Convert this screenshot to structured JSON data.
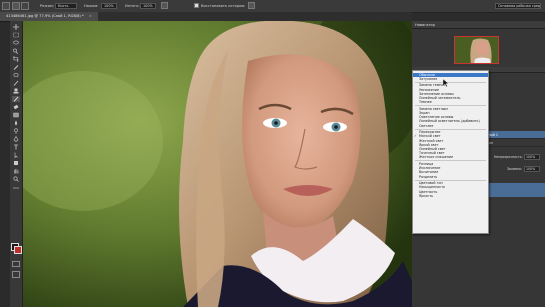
{
  "options_bar": {
    "mode_label": "Режим:",
    "mode_value": "Кисть",
    "pressure_label": "Нажим:",
    "pressure_value": "100%",
    "flow_label": "Интенс.:",
    "flow_value": "100%",
    "restore_history": "Восстановить историю",
    "workspace_value": "Основная рабочая среда"
  },
  "document": {
    "tab_title": "413486461.jpg @ 77,9% (Слой 1, RGB/8) *"
  },
  "panels": {
    "navigator_title": "Навигатор",
    "layers_mode_value": "Обычные",
    "opacity_label": "Непрозрачность:",
    "opacity_value": "100%",
    "fill_label": "Заливка:",
    "fill_value": "100%",
    "layer_items": [
      "Слой 1",
      "Фон"
    ]
  },
  "blend_modes": {
    "groups": [
      [
        "Обычные",
        "Затухание"
      ],
      [
        "Замена темным",
        "Умножение",
        "Затемнение основы",
        "Линейный затемнитель",
        "Темнее"
      ],
      [
        "Замена светлым",
        "Экран",
        "Осветление основы",
        "Линейный осветлитель (добавить)",
        "Светлее"
      ],
      [
        "Перекрытие",
        "Мягкий свет",
        "Жесткий свет",
        "Яркий свет",
        "Линейный свет",
        "Точечный свет",
        "Жесткое смешение"
      ],
      [
        "Разница",
        "Исключение",
        "Вычитание",
        "Разделить"
      ],
      [
        "Цветовой тон",
        "Насыщенность",
        "Цветность",
        "Яркость"
      ]
    ],
    "highlighted": "Обычные",
    "checked": "Мягкий свет"
  },
  "colors": {
    "foreground": "#1a1a1a",
    "background": "#c0302a",
    "accent": "#3b78c7"
  },
  "icons": [
    "photoshop-logo-icon",
    "brush-icon",
    "move-icon",
    "marquee-icon",
    "lasso-icon",
    "quick-select-icon",
    "crop-icon",
    "eyedropper-icon",
    "healing-icon",
    "brush-tool-icon",
    "stamp-icon",
    "history-brush-icon",
    "eraser-icon",
    "gradient-icon",
    "blur-icon",
    "dodge-icon",
    "pen-icon",
    "type-icon",
    "path-select-icon",
    "shape-icon",
    "hand-icon",
    "zoom-icon",
    "cursor-icon",
    "check-icon"
  ]
}
